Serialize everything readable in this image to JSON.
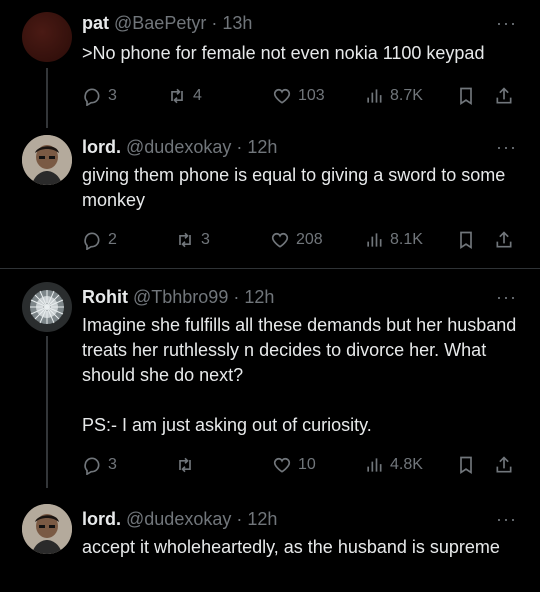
{
  "tweets": [
    {
      "name": "pat",
      "handle": "@BaePetyr",
      "time": "13h",
      "text": ">No phone for female not even nokia 1100 keypad",
      "replies": "3",
      "retweets": "4",
      "likes": "103",
      "views": "8.7K"
    },
    {
      "name": "lord.",
      "handle": "@dudexokay",
      "time": "12h",
      "text": "giving them phone is equal to giving a sword to some monkey",
      "replies": "2",
      "retweets": "3",
      "likes": "208",
      "views": "8.1K"
    },
    {
      "name": "Rohit",
      "handle": "@Tbhbro99",
      "time": "12h",
      "text": "Imagine she fulfills all these demands but her husband treats her ruthlessly n decides to divorce her. What should she do next?\n\nPS:- I am just asking out of curiosity.",
      "replies": "3",
      "retweets": "",
      "likes": "10",
      "views": "4.8K"
    },
    {
      "name": "lord.",
      "handle": "@dudexokay",
      "time": "12h",
      "text": "accept it wholeheartedly, as the husband is supreme"
    }
  ],
  "icons": {
    "more": "more-options-icon",
    "reply": "reply-icon",
    "retweet": "retweet-icon",
    "like": "like-icon",
    "views": "views-icon",
    "bookmark": "bookmark-icon",
    "share": "share-icon"
  },
  "colors": {
    "background": "#000000",
    "text_primary": "#e7e9ea",
    "text_secondary": "#71767b",
    "divider": "#2f3336"
  }
}
